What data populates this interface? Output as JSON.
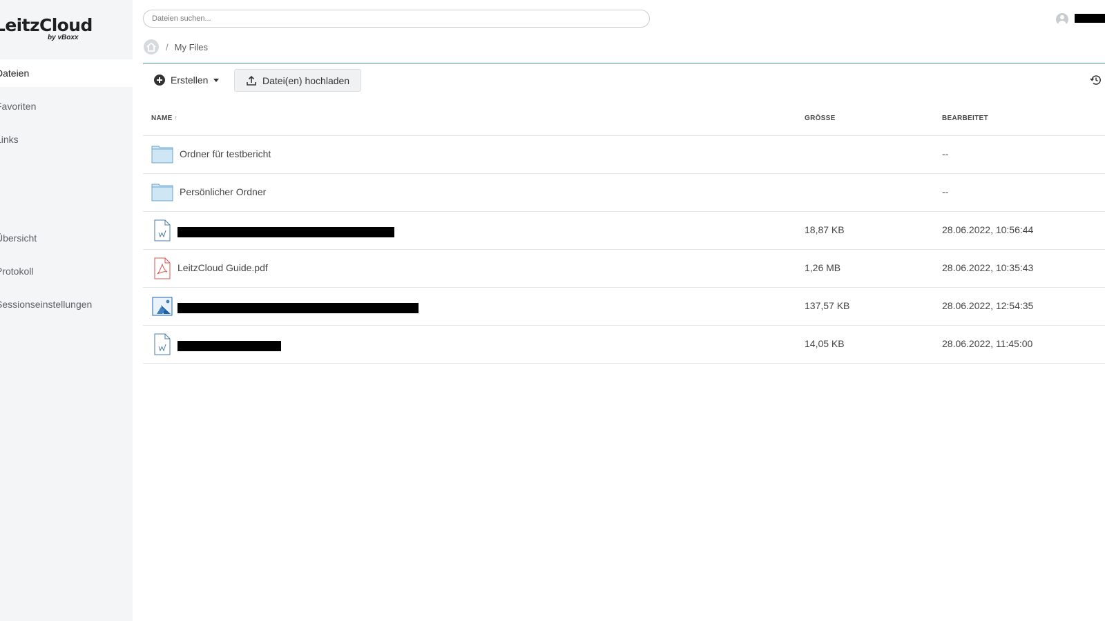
{
  "sidebar": {
    "logo_main": "LeitzCloud",
    "logo_sub": "by vBoxx",
    "items": [
      {
        "label": "Dateien",
        "active": true
      },
      {
        "label": "Favoriten"
      },
      {
        "label": "Links"
      },
      {
        "label": "Übersicht"
      },
      {
        "label": "Protokoll"
      },
      {
        "label": "Sessionseinstellungen"
      }
    ]
  },
  "search": {
    "placeholder": "Dateien suchen...",
    "value": ""
  },
  "user": {
    "avatar_icon": "user-avatar-icon"
  },
  "breadcrumb": {
    "home_icon": "home-icon",
    "separator": "/",
    "current": "My Files"
  },
  "toolbar": {
    "create_label": "Erstellen",
    "upload_label": "Datei(en) hochladen",
    "history_icon": "history-icon"
  },
  "table": {
    "columns": {
      "name": "NAME",
      "name_sort": "↑",
      "size": "GRÖSSE",
      "edited": "BEARBEITET"
    },
    "rows": [
      {
        "type": "folder",
        "name": "Ordner für testbericht",
        "size": "",
        "edited": "--"
      },
      {
        "type": "folder",
        "name": "Persönlicher Ordner",
        "size": "",
        "edited": "--"
      },
      {
        "type": "doc",
        "name": "",
        "redacted": true,
        "size": "18,87 KB",
        "edited": "28.06.2022, 10:56:44"
      },
      {
        "type": "pdf",
        "name": "LeitzCloud Guide.pdf",
        "size": "1,26 MB",
        "edited": "28.06.2022, 10:35:43"
      },
      {
        "type": "image",
        "name": "",
        "redacted": true,
        "size": "137,57 KB",
        "edited": "28.06.2022, 12:54:35"
      },
      {
        "type": "doc",
        "name": "",
        "redacted": true,
        "size": "14,05 KB",
        "edited": "28.06.2022, 11:45:00"
      }
    ]
  },
  "colors": {
    "accent_line": "#4a9a86",
    "sidebar_bg": "#f4f5f6",
    "folder": "#cfe6f5",
    "pdf": "#d9534f"
  }
}
